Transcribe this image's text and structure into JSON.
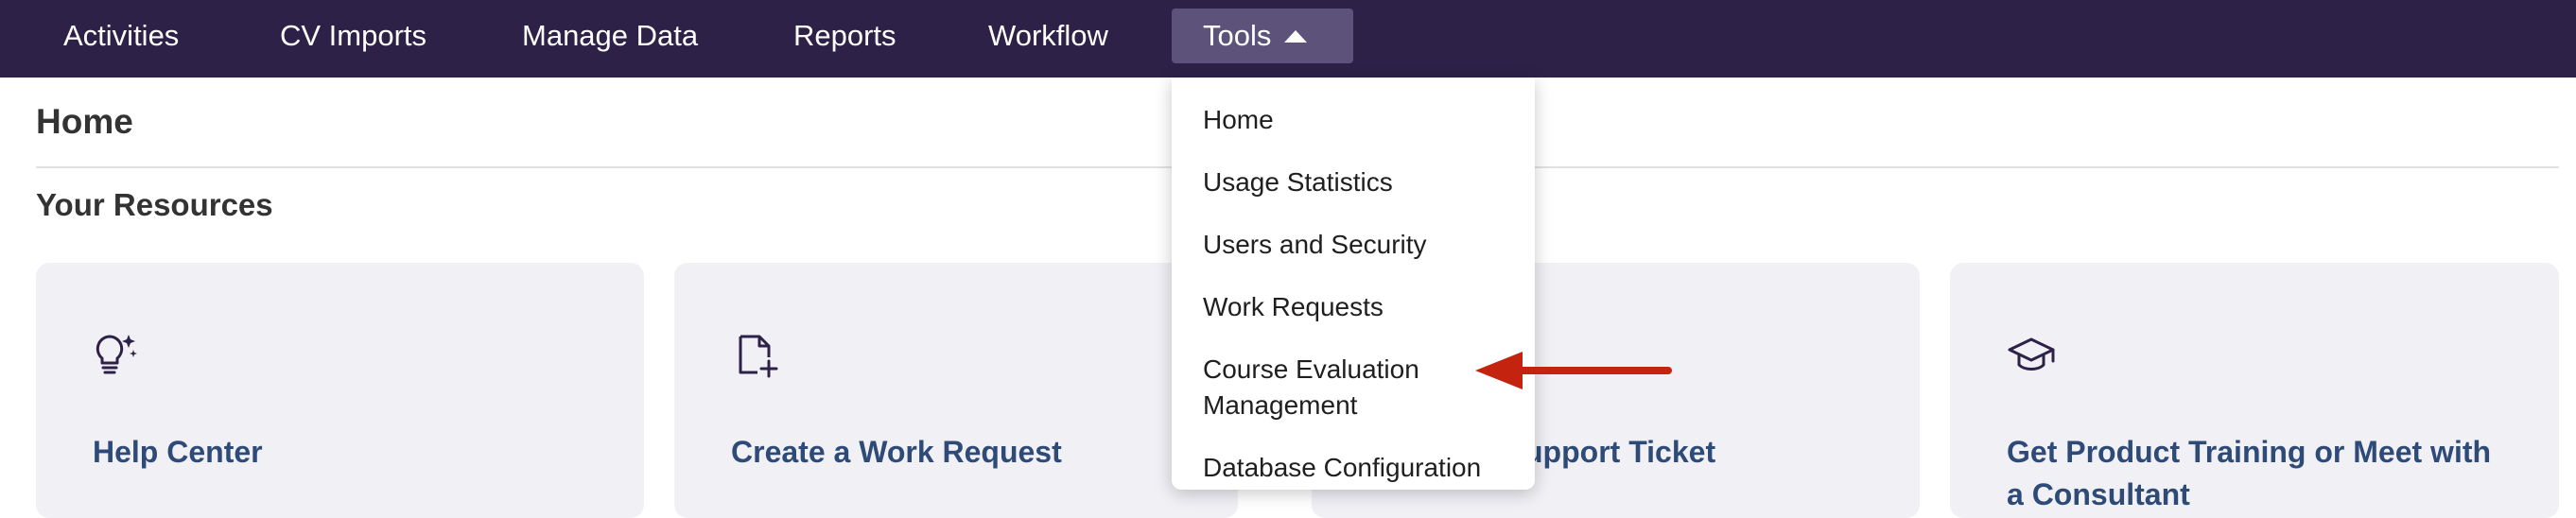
{
  "nav": {
    "items": [
      {
        "label": "Activities"
      },
      {
        "label": "CV Imports"
      },
      {
        "label": "Manage Data"
      },
      {
        "label": "Reports"
      },
      {
        "label": "Workflow"
      },
      {
        "label": "Tools"
      }
    ],
    "active": "Tools",
    "background": "#2d2148",
    "active_background": "#5d5279"
  },
  "page": {
    "title": "Home",
    "section_title": "Your Resources"
  },
  "cards": [
    {
      "title": "Help Center",
      "icon": "lightbulb-sparkle-icon"
    },
    {
      "title": "Create a Work Request",
      "icon": "file-plus-icon"
    },
    {
      "title": "upport Ticket",
      "icon": "ticket-icon"
    },
    {
      "title": "Get Product Training or Meet with a Consultant",
      "icon": "graduation-cap-icon"
    }
  ],
  "tools_menu": {
    "items": [
      {
        "label": "Home"
      },
      {
        "label": "Usage Statistics"
      },
      {
        "label": "Users and Security"
      },
      {
        "label": "Work Requests"
      },
      {
        "label": "Course Evaluation Management"
      },
      {
        "label": "Database Configuration"
      }
    ],
    "highlighted_item": "Course Evaluation Management"
  },
  "annotation": {
    "arrow_color": "#c4230f",
    "points_to": "Course Evaluation Management"
  },
  "colors": {
    "card_background": "#f1f0f5",
    "card_title": "#2e4b78",
    "heading": "#333333"
  }
}
